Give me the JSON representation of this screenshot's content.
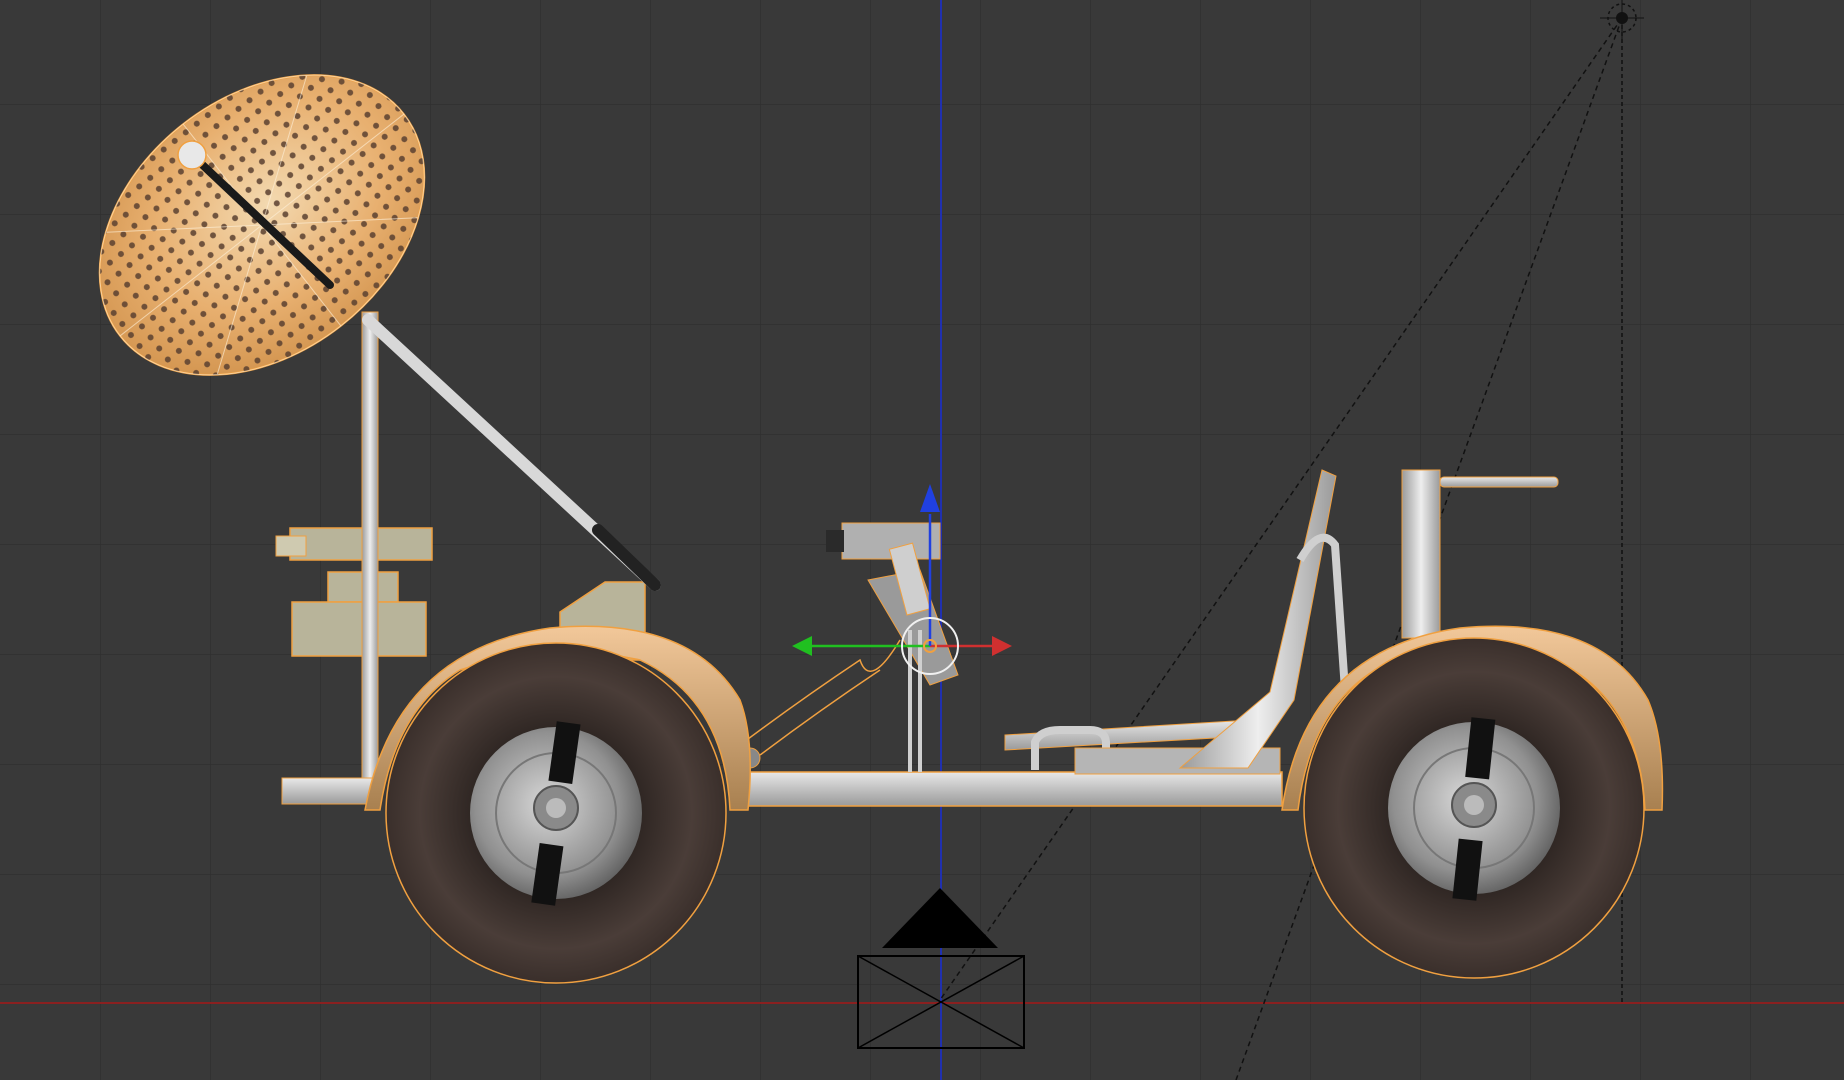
{
  "viewport": {
    "background": "#393939",
    "grid_color": "#2f2f2f",
    "selection_outline_color": "#f0a040",
    "view": "front-orthographic"
  },
  "scene_objects": [
    {
      "name": "lunar-rover",
      "selected": true
    },
    {
      "name": "high-gain-antenna-dish",
      "selected": true
    },
    {
      "name": "camera-object",
      "selected": false
    },
    {
      "name": "sun-lamp",
      "selected": false
    }
  ],
  "manipulator": {
    "x_axis_color": "#d03030",
    "y_axis_color": "#20c020",
    "z_axis_color": "#2040e0"
  },
  "axis_lines": {
    "x_axis_color": "#8a2020",
    "z_axis_color": "#2030b0"
  },
  "icons": [
    "transform-widget-icon",
    "camera-icon",
    "lamp-icon",
    "origin-point-icon"
  ]
}
